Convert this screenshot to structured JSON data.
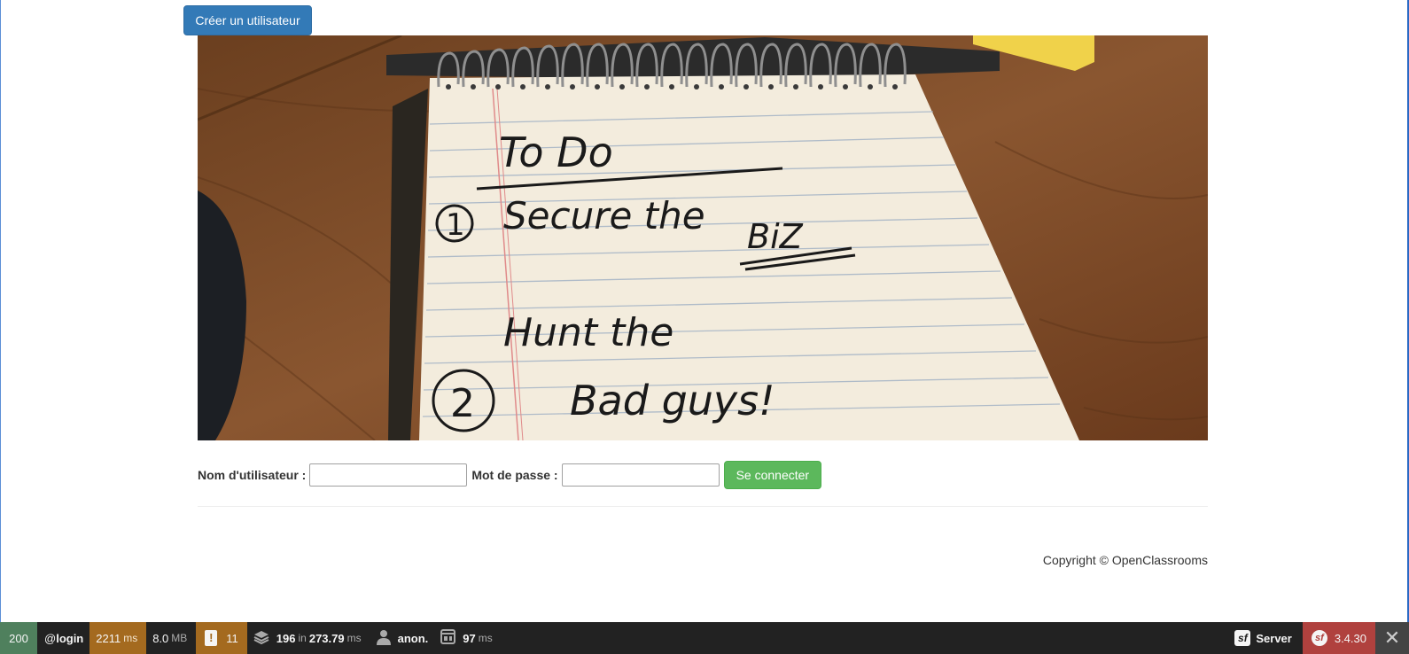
{
  "create_user_button": "Créer un utilisateur",
  "hero": {
    "handwriting_line1": "To Do",
    "handwriting_line2": "Secure the",
    "handwriting_line3": "BiZ",
    "handwriting_line4": "Hunt the",
    "handwriting_line5": "Bad guys!",
    "circle_1": "1",
    "circle_2": "2"
  },
  "login": {
    "username_label": "Nom d'utilisateur :",
    "username_value": "",
    "password_label": "Mot de passe :",
    "password_value": "",
    "submit_label": "Se connecter"
  },
  "footer": {
    "copyright": "Copyright © OpenClassrooms"
  },
  "toolbar": {
    "status_code": "200",
    "route_prefix": "@",
    "route": "login",
    "time_value": "2211",
    "time_unit": "ms",
    "memory_value": "8.0",
    "memory_unit": "MB",
    "warnings_count": "11",
    "cache_value": "196",
    "cache_in": "in",
    "cache_time": "273.79",
    "cache_unit": "ms",
    "user": "anon.",
    "render_value": "97",
    "render_unit": "ms",
    "server_label": "Server",
    "version": "3.4.30",
    "colors": {
      "status_bg": "#4f805d",
      "time_bg": "#a46a1f",
      "version_bg": "#b0413e"
    }
  }
}
